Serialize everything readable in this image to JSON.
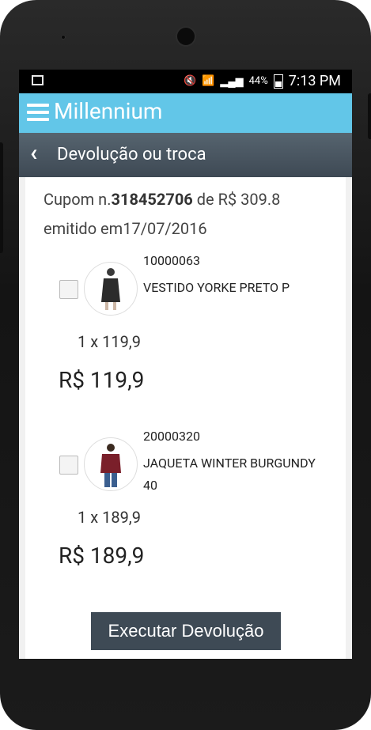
{
  "status": {
    "battery_pct": "44%",
    "time": "7:13 PM"
  },
  "app": {
    "title": "Millennium"
  },
  "page": {
    "title": "Devolução ou troca"
  },
  "coupon": {
    "prefix": "Cupom n.",
    "number": "318452706",
    "de_label": "de R$",
    "amount": "309.8",
    "issued_label": "emitido em",
    "date": "17/07/2016"
  },
  "items": [
    {
      "code": "10000063",
      "name": "VESTIDO YORKE PRETO P",
      "qty_line": "1 x 119,9",
      "total": "R$ 119,9"
    },
    {
      "code": "20000320",
      "name": "JAQUETA WINTER BURGUNDY 40",
      "qty_line": "1 x 189,9",
      "total": "R$ 189,9"
    }
  ],
  "actions": {
    "execute_label": "Executar Devolução"
  },
  "colors": {
    "appbar": "#62c6e8",
    "subbar": "#475460",
    "button": "#3e4a55"
  }
}
